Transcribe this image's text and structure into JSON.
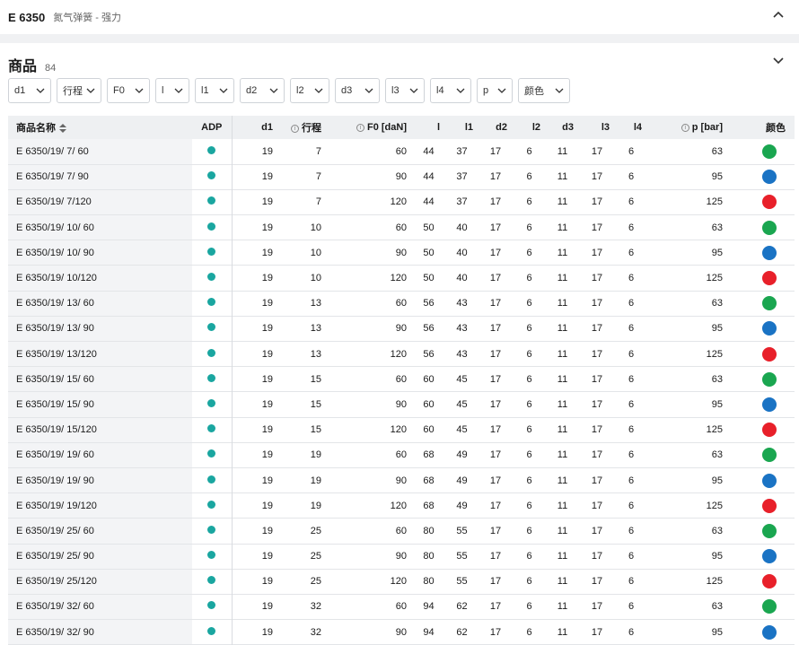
{
  "header": {
    "code": "E 6350",
    "description": "氮气弹簧 - 强力"
  },
  "section": {
    "title": "商品",
    "count": "84"
  },
  "filters": [
    "d1",
    "行程",
    "F0",
    "l",
    "l1",
    "d2",
    "l2",
    "d3",
    "l3",
    "l4",
    "p",
    "颜色"
  ],
  "table": {
    "columns": [
      "商品名称",
      "ADP",
      "d1",
      "行程",
      "F0 [daN]",
      "l",
      "l1",
      "d2",
      "l2",
      "d3",
      "l3",
      "l4",
      "p [bar]",
      "颜色"
    ],
    "rows": [
      {
        "name": "E 6350/19/ 7/ 60",
        "d1": "19",
        "stroke": "7",
        "f0": "60",
        "l": "44",
        "l1": "37",
        "d2": "17",
        "l2": "6",
        "d3": "11",
        "l3": "17",
        "l4": "6",
        "p": "63",
        "color": "green"
      },
      {
        "name": "E 6350/19/ 7/ 90",
        "d1": "19",
        "stroke": "7",
        "f0": "90",
        "l": "44",
        "l1": "37",
        "d2": "17",
        "l2": "6",
        "d3": "11",
        "l3": "17",
        "l4": "6",
        "p": "95",
        "color": "blue"
      },
      {
        "name": "E 6350/19/ 7/120",
        "d1": "19",
        "stroke": "7",
        "f0": "120",
        "l": "44",
        "l1": "37",
        "d2": "17",
        "l2": "6",
        "d3": "11",
        "l3": "17",
        "l4": "6",
        "p": "125",
        "color": "red"
      },
      {
        "name": "E 6350/19/ 10/ 60",
        "d1": "19",
        "stroke": "10",
        "f0": "60",
        "l": "50",
        "l1": "40",
        "d2": "17",
        "l2": "6",
        "d3": "11",
        "l3": "17",
        "l4": "6",
        "p": "63",
        "color": "green"
      },
      {
        "name": "E 6350/19/ 10/ 90",
        "d1": "19",
        "stroke": "10",
        "f0": "90",
        "l": "50",
        "l1": "40",
        "d2": "17",
        "l2": "6",
        "d3": "11",
        "l3": "17",
        "l4": "6",
        "p": "95",
        "color": "blue"
      },
      {
        "name": "E 6350/19/ 10/120",
        "d1": "19",
        "stroke": "10",
        "f0": "120",
        "l": "50",
        "l1": "40",
        "d2": "17",
        "l2": "6",
        "d3": "11",
        "l3": "17",
        "l4": "6",
        "p": "125",
        "color": "red"
      },
      {
        "name": "E 6350/19/ 13/ 60",
        "d1": "19",
        "stroke": "13",
        "f0": "60",
        "l": "56",
        "l1": "43",
        "d2": "17",
        "l2": "6",
        "d3": "11",
        "l3": "17",
        "l4": "6",
        "p": "63",
        "color": "green"
      },
      {
        "name": "E 6350/19/ 13/ 90",
        "d1": "19",
        "stroke": "13",
        "f0": "90",
        "l": "56",
        "l1": "43",
        "d2": "17",
        "l2": "6",
        "d3": "11",
        "l3": "17",
        "l4": "6",
        "p": "95",
        "color": "blue"
      },
      {
        "name": "E 6350/19/ 13/120",
        "d1": "19",
        "stroke": "13",
        "f0": "120",
        "l": "56",
        "l1": "43",
        "d2": "17",
        "l2": "6",
        "d3": "11",
        "l3": "17",
        "l4": "6",
        "p": "125",
        "color": "red"
      },
      {
        "name": "E 6350/19/ 15/ 60",
        "d1": "19",
        "stroke": "15",
        "f0": "60",
        "l": "60",
        "l1": "45",
        "d2": "17",
        "l2": "6",
        "d3": "11",
        "l3": "17",
        "l4": "6",
        "p": "63",
        "color": "green"
      },
      {
        "name": "E 6350/19/ 15/ 90",
        "d1": "19",
        "stroke": "15",
        "f0": "90",
        "l": "60",
        "l1": "45",
        "d2": "17",
        "l2": "6",
        "d3": "11",
        "l3": "17",
        "l4": "6",
        "p": "95",
        "color": "blue"
      },
      {
        "name": "E 6350/19/ 15/120",
        "d1": "19",
        "stroke": "15",
        "f0": "120",
        "l": "60",
        "l1": "45",
        "d2": "17",
        "l2": "6",
        "d3": "11",
        "l3": "17",
        "l4": "6",
        "p": "125",
        "color": "red"
      },
      {
        "name": "E 6350/19/ 19/ 60",
        "d1": "19",
        "stroke": "19",
        "f0": "60",
        "l": "68",
        "l1": "49",
        "d2": "17",
        "l2": "6",
        "d3": "11",
        "l3": "17",
        "l4": "6",
        "p": "63",
        "color": "green"
      },
      {
        "name": "E 6350/19/ 19/ 90",
        "d1": "19",
        "stroke": "19",
        "f0": "90",
        "l": "68",
        "l1": "49",
        "d2": "17",
        "l2": "6",
        "d3": "11",
        "l3": "17",
        "l4": "6",
        "p": "95",
        "color": "blue"
      },
      {
        "name": "E 6350/19/ 19/120",
        "d1": "19",
        "stroke": "19",
        "f0": "120",
        "l": "68",
        "l1": "49",
        "d2": "17",
        "l2": "6",
        "d3": "11",
        "l3": "17",
        "l4": "6",
        "p": "125",
        "color": "red"
      },
      {
        "name": "E 6350/19/ 25/ 60",
        "d1": "19",
        "stroke": "25",
        "f0": "60",
        "l": "80",
        "l1": "55",
        "d2": "17",
        "l2": "6",
        "d3": "11",
        "l3": "17",
        "l4": "6",
        "p": "63",
        "color": "green"
      },
      {
        "name": "E 6350/19/ 25/ 90",
        "d1": "19",
        "stroke": "25",
        "f0": "90",
        "l": "80",
        "l1": "55",
        "d2": "17",
        "l2": "6",
        "d3": "11",
        "l3": "17",
        "l4": "6",
        "p": "95",
        "color": "blue"
      },
      {
        "name": "E 6350/19/ 25/120",
        "d1": "19",
        "stroke": "25",
        "f0": "120",
        "l": "80",
        "l1": "55",
        "d2": "17",
        "l2": "6",
        "d3": "11",
        "l3": "17",
        "l4": "6",
        "p": "125",
        "color": "red"
      },
      {
        "name": "E 6350/19/ 32/ 60",
        "d1": "19",
        "stroke": "32",
        "f0": "60",
        "l": "94",
        "l1": "62",
        "d2": "17",
        "l2": "6",
        "d3": "11",
        "l3": "17",
        "l4": "6",
        "p": "63",
        "color": "green"
      },
      {
        "name": "E 6350/19/ 32/ 90",
        "d1": "19",
        "stroke": "32",
        "f0": "90",
        "l": "94",
        "l1": "62",
        "d2": "17",
        "l2": "6",
        "d3": "11",
        "l3": "17",
        "l4": "6",
        "p": "95",
        "color": "blue"
      }
    ]
  },
  "colors": {
    "green": "#1aa650",
    "blue": "#1a73c4",
    "red": "#e8202a",
    "adp": "#1aa6a0"
  }
}
